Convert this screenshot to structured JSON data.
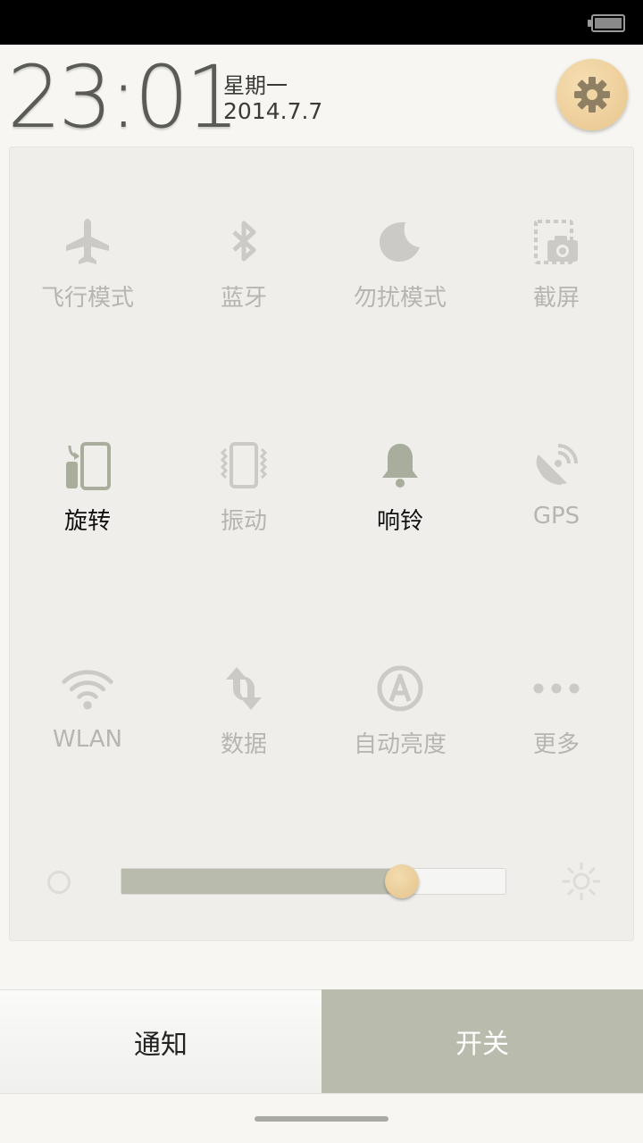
{
  "status_bar": {
    "battery_icon": "battery-icon"
  },
  "header": {
    "time": "23:01",
    "weekday": "星期一",
    "date": "2014.7.7",
    "settings_icon": "gear-icon"
  },
  "toggles": [
    {
      "label": "飞行模式",
      "icon": "airplane-icon",
      "active": false
    },
    {
      "label": "蓝牙",
      "icon": "bluetooth-icon",
      "active": false
    },
    {
      "label": "勿扰模式",
      "icon": "moon-icon",
      "active": false
    },
    {
      "label": "截屏",
      "icon": "screenshot-icon",
      "active": false
    },
    {
      "label": "旋转",
      "icon": "rotate-icon",
      "active": true
    },
    {
      "label": "振动",
      "icon": "vibrate-icon",
      "active": false
    },
    {
      "label": "响铃",
      "icon": "bell-icon",
      "active": true
    },
    {
      "label": "GPS",
      "icon": "gps-icon",
      "active": false
    },
    {
      "label": "WLAN",
      "icon": "wifi-icon",
      "active": false
    },
    {
      "label": "数据",
      "icon": "data-icon",
      "active": false
    },
    {
      "label": "自动亮度",
      "icon": "auto-brightness-icon",
      "active": false
    },
    {
      "label": "更多",
      "icon": "more-icon",
      "active": false
    }
  ],
  "brightness": {
    "level": 0.73
  },
  "tabs": {
    "notify": "通知",
    "switch": "开关"
  },
  "colors": {
    "active_icon": "#a9ad9b",
    "inactive": "#cbcac6",
    "accent": "#b9bcad",
    "wood": "#e8c58c"
  }
}
